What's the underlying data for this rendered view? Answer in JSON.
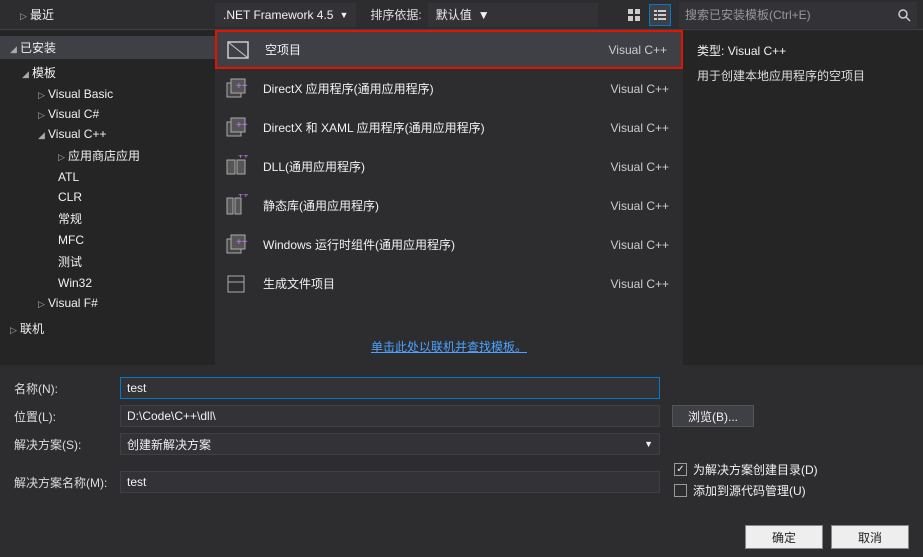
{
  "topbar": {
    "recent": "最近",
    "framework": ".NET Framework 4.5",
    "sort_label": "排序依据:",
    "sort_value": "默认值",
    "search_placeholder": "搜索已安装模板(Ctrl+E)"
  },
  "tree": {
    "installed": "已安装",
    "templates": "模板",
    "items": [
      "Visual Basic",
      "Visual C#",
      "Visual C++"
    ],
    "vcpp_children": [
      "应用商店应用",
      "ATL",
      "CLR",
      "常规",
      "MFC",
      "测试",
      "Win32"
    ],
    "vfsharp": "Visual F#",
    "online": "联机"
  },
  "templates": [
    {
      "name": "空项目",
      "type": "Visual C++"
    },
    {
      "name": "DirectX 应用程序(通用应用程序)",
      "type": "Visual C++"
    },
    {
      "name": "DirectX 和 XAML 应用程序(通用应用程序)",
      "type": "Visual C++"
    },
    {
      "name": "DLL(通用应用程序)",
      "type": "Visual C++"
    },
    {
      "name": "静态库(通用应用程序)",
      "type": "Visual C++"
    },
    {
      "name": "Windows 运行时组件(通用应用程序)",
      "type": "Visual C++"
    },
    {
      "name": "生成文件项目",
      "type": "Visual C++"
    }
  ],
  "online_link": "单击此处以联机并查找模板。",
  "details": {
    "type_label": "类型:",
    "type_value": "Visual C++",
    "description": "用于创建本地应用程序的空项目"
  },
  "form": {
    "name_label": "名称(N):",
    "name_value": "test",
    "location_label": "位置(L):",
    "location_value": "D:\\Code\\C++\\dll\\",
    "browse": "浏览(B)...",
    "solution_label": "解决方案(S):",
    "solution_value": "创建新解决方案",
    "solution_name_label": "解决方案名称(M):",
    "solution_name_value": "test",
    "chk_create_dir": "为解决方案创建目录(D)",
    "chk_source_control": "添加到源代码管理(U)"
  },
  "buttons": {
    "ok": "确定",
    "cancel": "取消"
  }
}
